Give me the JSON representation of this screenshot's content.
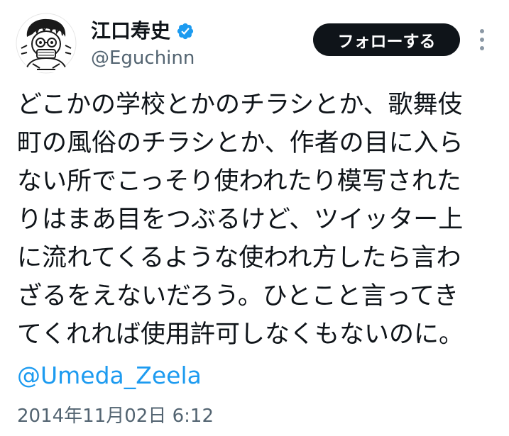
{
  "author": {
    "display_name": "江口寿史",
    "handle": "@Eguchinn",
    "verified_icon": "verified-badge-icon",
    "avatar_icon": "avatar-illustration"
  },
  "actions": {
    "follow_label": "フォローする",
    "more_icon": "more-vertical-icon"
  },
  "tweet": {
    "lines": [
      "どこかの学校とかのチラシとか、歌舞伎",
      "町の風俗のチラシとか、作者の目に入ら",
      "ない所でこっそり使われたり模写された",
      "りはまあ目をつぶるけど、ツイッター上",
      "に流れてくるような使われ方したら言わ",
      "ざるをえないだろう。ひとこと言ってき",
      "てくれれば使用許可しなくもないのに。"
    ],
    "mention": "@Umeda_Zeela",
    "timestamp": "2014年11月02日 6:12"
  },
  "colors": {
    "text": "#0f1419",
    "secondary": "#536471",
    "link": "#1d9bf0",
    "verified": "#1d9bf0",
    "button_bg": "#0f1419"
  }
}
